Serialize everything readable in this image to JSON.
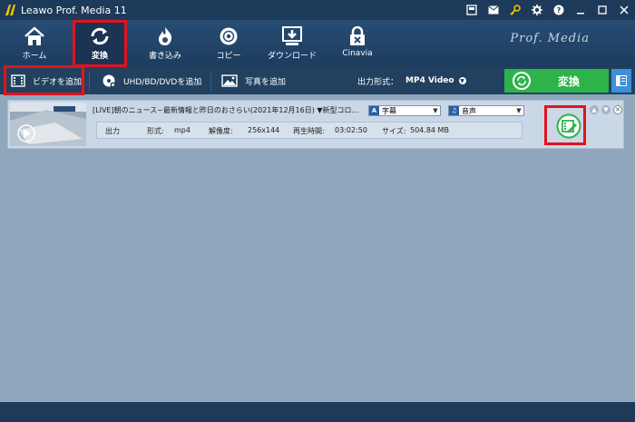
{
  "app": {
    "title": "Leawo Prof. Media 11"
  },
  "titlebar_icons": [
    "store-icon",
    "mail-icon",
    "key-icon",
    "gear-icon",
    "help-icon",
    "minimize-icon",
    "maximize-icon",
    "close-icon"
  ],
  "nav": {
    "items": [
      {
        "label": "ホーム",
        "icon": "home-icon"
      },
      {
        "label": "変換",
        "icon": "convert-icon"
      },
      {
        "label": "書き込み",
        "icon": "burn-icon"
      },
      {
        "label": "コピー",
        "icon": "disc-icon"
      },
      {
        "label": "ダウンロード",
        "icon": "download-icon"
      },
      {
        "label": "Cinavia",
        "icon": "cinavia-icon"
      }
    ],
    "active": "変換",
    "brand": "Prof. Media"
  },
  "toolbar": {
    "add_video": "ビデオを追加",
    "add_disc": "UHD/BD/DVDを追加",
    "add_photo": "写真を追加",
    "output_format_label": "出力形式：",
    "output_format_value": "MP4 Video",
    "convert_label": "変換"
  },
  "file": {
    "title": "[LIVE]朝のニュース~最新情報と昨日のおさらい(2021年12月16日) ▼新型コロ…",
    "subtitle_select": "字幕",
    "audio_select": "音声",
    "output_label": "出力",
    "format_label": "形式:",
    "format_value": "mp4",
    "resolution_label": "解像度:",
    "resolution_value": "256x144",
    "duration_label": "再生時間:",
    "duration_value": "03:02:50",
    "size_label": "サイズ:",
    "size_value": "504.84 MB"
  },
  "colors": {
    "accent_green": "#2DB34A",
    "highlight_red": "#E0141E",
    "nav_bg": "#274D73",
    "content_bg": "#8FA7BD"
  }
}
